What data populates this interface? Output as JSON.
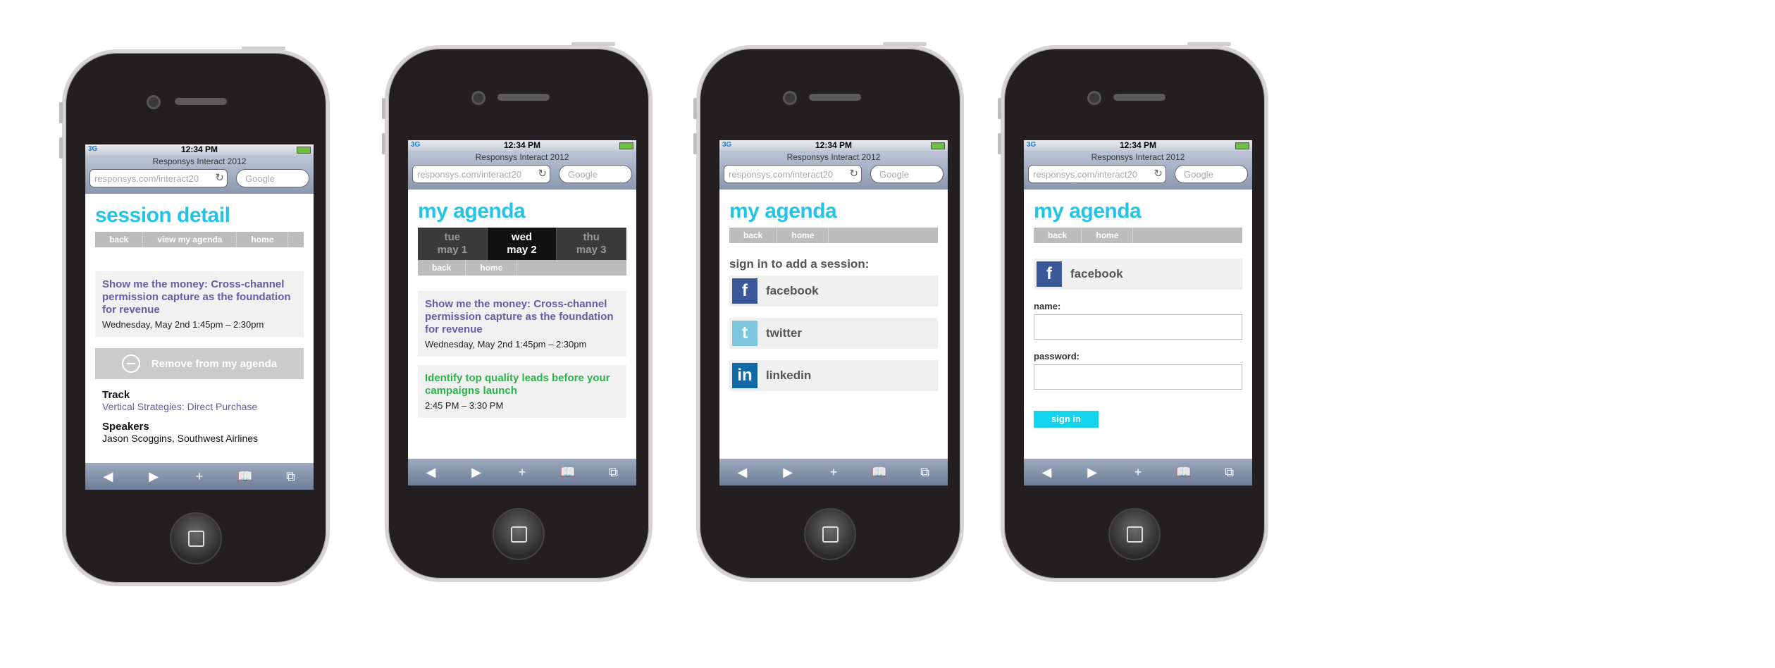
{
  "browser": {
    "time": "12:34 PM",
    "signal": "3G",
    "title": "Responsys Interact 2012",
    "url": "responsys.com/interact20",
    "search_placeholder": "Google"
  },
  "toolbar": {
    "back": "◀",
    "forward": "▶",
    "add": "+",
    "bookmarks": "📖",
    "tabs": "⧉"
  },
  "screen1": {
    "title": "session detail",
    "nav": [
      "back",
      "view my agenda",
      "home"
    ],
    "session_title": "Show me the money: Cross-channel permission capture as the foundation for revenue",
    "session_date": "Wednesday, May 2nd  1:45pm – 2:30pm",
    "remove_label": "Remove from my agenda",
    "track_label": "Track",
    "track_value": "Vertical Strategies: Direct Purchase",
    "speakers_label": "Speakers",
    "speakers_value": "Jason Scoggins, Southwest Airlines"
  },
  "screen2": {
    "title": "my agenda",
    "days": [
      {
        "day": "tue",
        "date": "may 1"
      },
      {
        "day": "wed",
        "date": "may 2"
      },
      {
        "day": "thu",
        "date": "may 3"
      }
    ],
    "nav": [
      "back",
      "home"
    ],
    "sessions": [
      {
        "title": "Show me the money: Cross-channel permission capture as the foundation for revenue",
        "time": "Wednesday, May 2nd  1:45pm – 2:30pm"
      },
      {
        "title": "Identify top quality leads before your campaigns launch",
        "time": "2:45 PM – 3:30 PM"
      }
    ]
  },
  "screen3": {
    "title": "my agenda",
    "nav": [
      "back",
      "home"
    ],
    "prompt": "sign in to add a session:",
    "networks": [
      "facebook",
      "twitter",
      "linkedin"
    ]
  },
  "screen4": {
    "title": "my agenda",
    "nav": [
      "back",
      "home"
    ],
    "network": "facebook",
    "name_label": "name:",
    "password_label": "password:",
    "signin_label": "sign in"
  },
  "colors": {
    "accent": "#22c3e6",
    "session_title": "#6a5aa8",
    "session_green": "#2cb34a",
    "facebook": "#3b5998",
    "twitter": "#7dc6dd",
    "linkedin": "#0f6aa6"
  }
}
